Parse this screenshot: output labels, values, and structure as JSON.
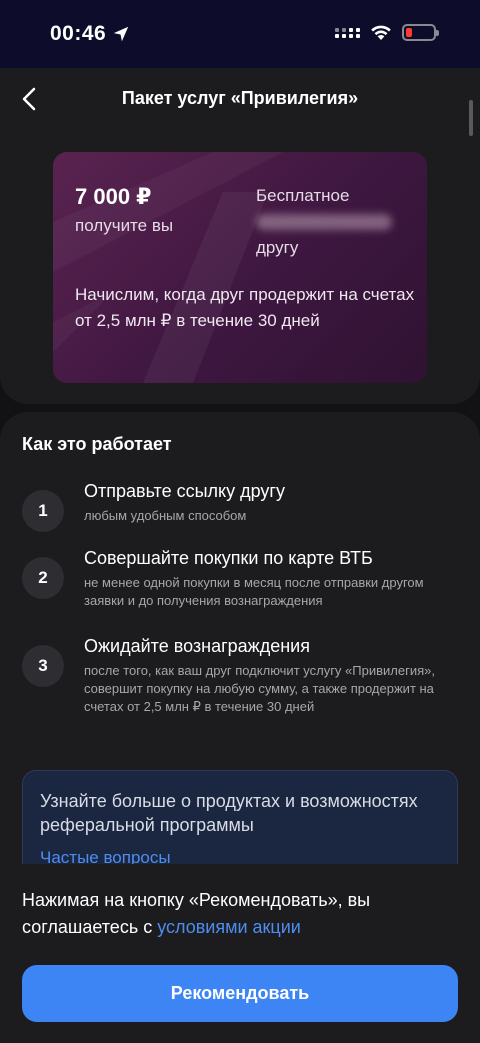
{
  "status_bar": {
    "time": "00:46",
    "icons": [
      "location-icon",
      "signal-icon",
      "wifi-icon",
      "battery-icon"
    ],
    "battery_color": "#ff3b30"
  },
  "header": {
    "title": "Пакет услуг «Привилегия»",
    "back_icon": "chevron-left-icon"
  },
  "promo_card": {
    "amount": "7 000 ₽",
    "amount_caption": "получите вы",
    "free_label": "Бесплатное",
    "friend_label": "другу",
    "description": "Начислим, когда друг продержит на счетах от 2,5 млн ₽ в течение 30 дней"
  },
  "how_it_works": {
    "title": "Как это работает",
    "steps": [
      {
        "num": "1",
        "title": "Отправьте ссылку другу",
        "desc": "любым удобным способом"
      },
      {
        "num": "2",
        "title": "Совершайте покупки по карте ВТБ",
        "desc": "не менее одной покупки в месяц после отправки другом заявки и до получения вознаграждения"
      },
      {
        "num": "3",
        "title": "Ожидайте вознаграждения",
        "desc": "после того, как ваш друг подключит услугу «Привилегия», совершит покупку на любую сумму, а также продержит на счетах от 2,5 млн ₽ в течение 30 дней"
      }
    ]
  },
  "info_card": {
    "text": "Узнайте больше о продуктах и возможностях реферальной программы",
    "link": "Частые вопросы"
  },
  "footer": {
    "terms_prefix": "Нажимая на кнопку «Рекомендовать», вы соглашаетесь с ",
    "terms_link": "условиями акции",
    "button_label": "Рекомендовать"
  },
  "colors": {
    "accent": "#3d85f5",
    "link": "#4d8df0",
    "background": "#1c1c1e",
    "card": "#4a1c46"
  }
}
